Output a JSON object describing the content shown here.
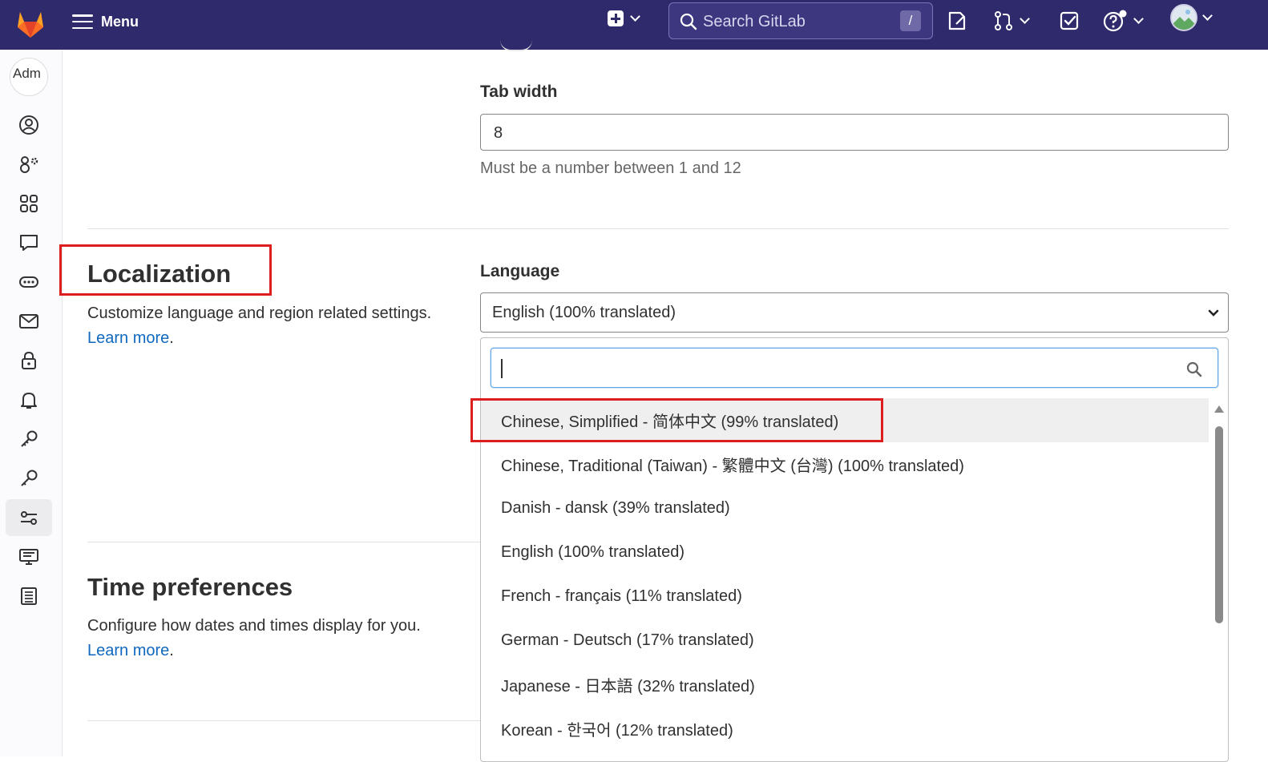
{
  "topbar": {
    "menu_label": "Menu",
    "search_placeholder": "Search GitLab",
    "search_shortcut": "/",
    "icons": [
      "gitlab-logo",
      "hamburger-icon",
      "plus-square-icon",
      "chevron-down-icon",
      "search-icon",
      "issues-icon",
      "merge-request-icon",
      "todo-icon",
      "help-icon",
      "user-avatar"
    ]
  },
  "rail": {
    "avatar_alt": "Adm",
    "items": [
      "profile",
      "account",
      "applications",
      "chat",
      "access-tokens",
      "emails",
      "password",
      "notifications",
      "ssh-keys",
      "gpg-keys",
      "preferences",
      "active-sessions",
      "authentication-log"
    ],
    "active_item": "preferences"
  },
  "tab_width": {
    "label": "Tab width",
    "value": "8",
    "help": "Must be a number between 1 and 12"
  },
  "localization": {
    "title": "Localization",
    "description": "Customize language and region related settings.",
    "learn_more": "Learn more",
    "language_label": "Language",
    "selected": "English (100% translated)",
    "search_value": "",
    "options": [
      "Chinese, Simplified - 简体中文 (99% translated)",
      "Chinese, Traditional (Taiwan) - 繁體中文 (台灣) (100% translated)",
      "Danish - dansk (39% translated)",
      "English (100% translated)",
      "French - français (11% translated)",
      "German - Deutsch (17% translated)",
      "Japanese - 日本語 (32% translated)",
      "Korean - 한국어 (12% translated)"
    ],
    "highlighted_index": 0
  },
  "time_preferences": {
    "title": "Time preferences",
    "description": "Configure how dates and times display for you.",
    "learn_more": "Learn more"
  },
  "colors": {
    "topbar": "#2f2a6b",
    "link": "#1068bf",
    "annotation": "#dd1e1e"
  }
}
